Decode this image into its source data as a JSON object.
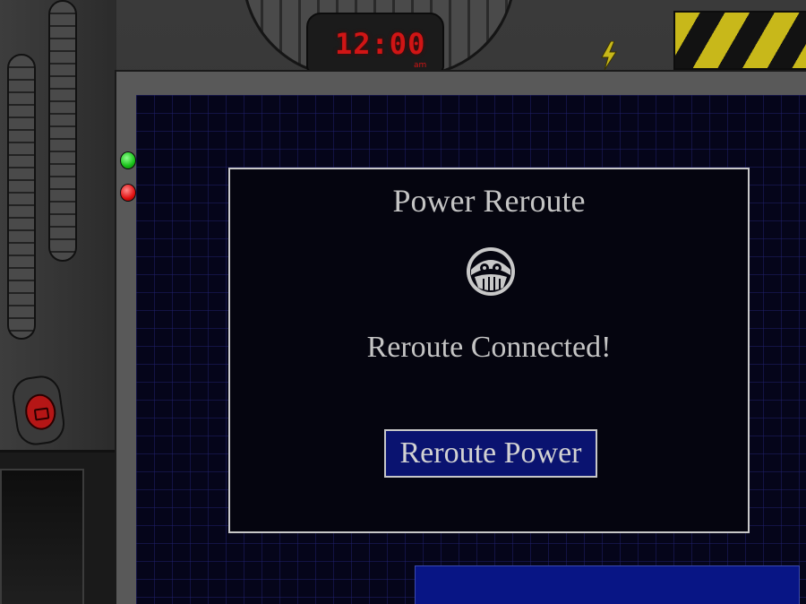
{
  "clock": {
    "time": "12:00",
    "ampm": "am",
    "color": "#d01515"
  },
  "dialog": {
    "title": "Power Reroute",
    "logo_icon": "robotnik-emblem-icon",
    "status": "Reroute Connected!",
    "button_label": "Reroute Power"
  },
  "indicators": {
    "green_led": "#17c017",
    "red_led": "#e01010"
  },
  "colors": {
    "screen_background": "#05051a",
    "grid_line": "#23237a",
    "button_fill": "#0a1370",
    "text": "#c4c4c4",
    "bottom_bar": "#081585",
    "hazard_yellow": "#c8b81a"
  }
}
